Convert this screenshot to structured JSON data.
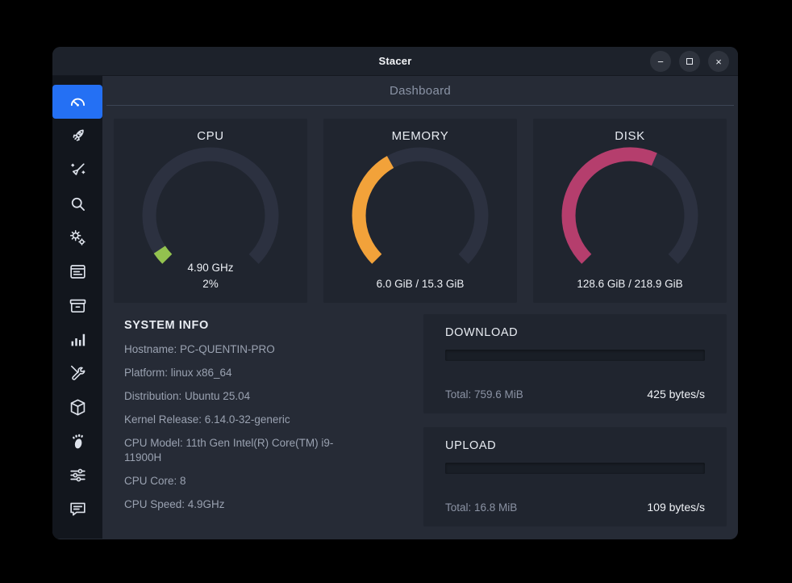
{
  "titlebar": {
    "title": "Stacer",
    "minimize_glyph": "−",
    "close_glyph": "×"
  },
  "header": {
    "title": "Dashboard"
  },
  "sidebar": {
    "active_index": 0,
    "items": [
      {
        "name": "dashboard"
      },
      {
        "name": "startup-apps"
      },
      {
        "name": "system-cleaner"
      },
      {
        "name": "search"
      },
      {
        "name": "services"
      },
      {
        "name": "processes"
      },
      {
        "name": "uninstaller"
      },
      {
        "name": "resources"
      },
      {
        "name": "helpers"
      },
      {
        "name": "apt-repository"
      },
      {
        "name": "gnome-settings"
      },
      {
        "name": "settings"
      },
      {
        "name": "feedback"
      }
    ]
  },
  "gauges": [
    {
      "title": "CPU",
      "value_top": "4.90 GHz",
      "value_bottom": "2%",
      "percent": 2,
      "color": "#93c24f",
      "track_color": "#2c3140"
    },
    {
      "title": "MEMORY",
      "value_top": "",
      "value_bottom": "6.0 GiB / 15.3 GiB",
      "percent": 39.2,
      "color": "#f2a23a",
      "track_color": "#2c3140"
    },
    {
      "title": "DISK",
      "value_top": "",
      "value_bottom": "128.6 GiB / 218.9 GiB",
      "percent": 58.7,
      "color": "#b53e6d",
      "track_color": "#2c3140"
    }
  ],
  "system_info": {
    "heading": "SYSTEM INFO",
    "lines": [
      "Hostname: PC-QUENTIN-PRO",
      "Platform: linux x86_64",
      "Distribution: Ubuntu 25.04",
      "Kernel Release: 6.14.0-32-generic",
      "CPU Model: 11th Gen Intel(R) Core(TM) i9-11900H",
      "CPU Core: 8",
      "CPU Speed: 4.9GHz"
    ]
  },
  "network": {
    "download": {
      "title": "DOWNLOAD",
      "total": "Total: 759.6 MiB",
      "rate": "425 bytes/s",
      "progress_percent": 0
    },
    "upload": {
      "title": "UPLOAD",
      "total": "Total: 16.8 MiB",
      "rate": "109 bytes/s",
      "progress_percent": 0
    }
  }
}
